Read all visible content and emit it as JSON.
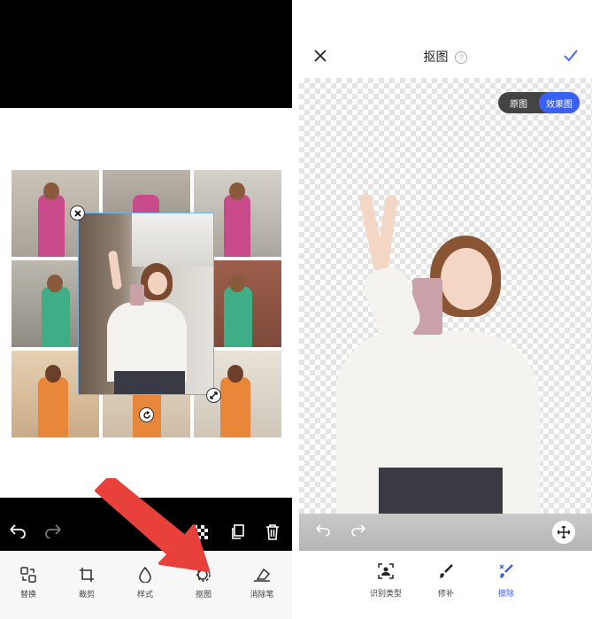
{
  "left": {
    "toolbar": [
      {
        "label": "替换",
        "icon": "swap-icon"
      },
      {
        "label": "裁剪",
        "icon": "crop-icon"
      },
      {
        "label": "样式",
        "icon": "drop-icon"
      },
      {
        "label": "抠图",
        "icon": "cutout-icon"
      },
      {
        "label": "消除笔",
        "icon": "eraser-icon"
      }
    ]
  },
  "right": {
    "header": {
      "title": "抠图",
      "help": "?"
    },
    "toggle": {
      "original": "原图",
      "result": "效果图"
    },
    "toolbar": [
      {
        "label": "识别类型",
        "icon": "recognize-icon"
      },
      {
        "label": "修补",
        "icon": "brush-icon"
      },
      {
        "label": "擦除",
        "icon": "erase-brush-icon",
        "active": true
      }
    ],
    "accent": "#3a5ff5"
  }
}
